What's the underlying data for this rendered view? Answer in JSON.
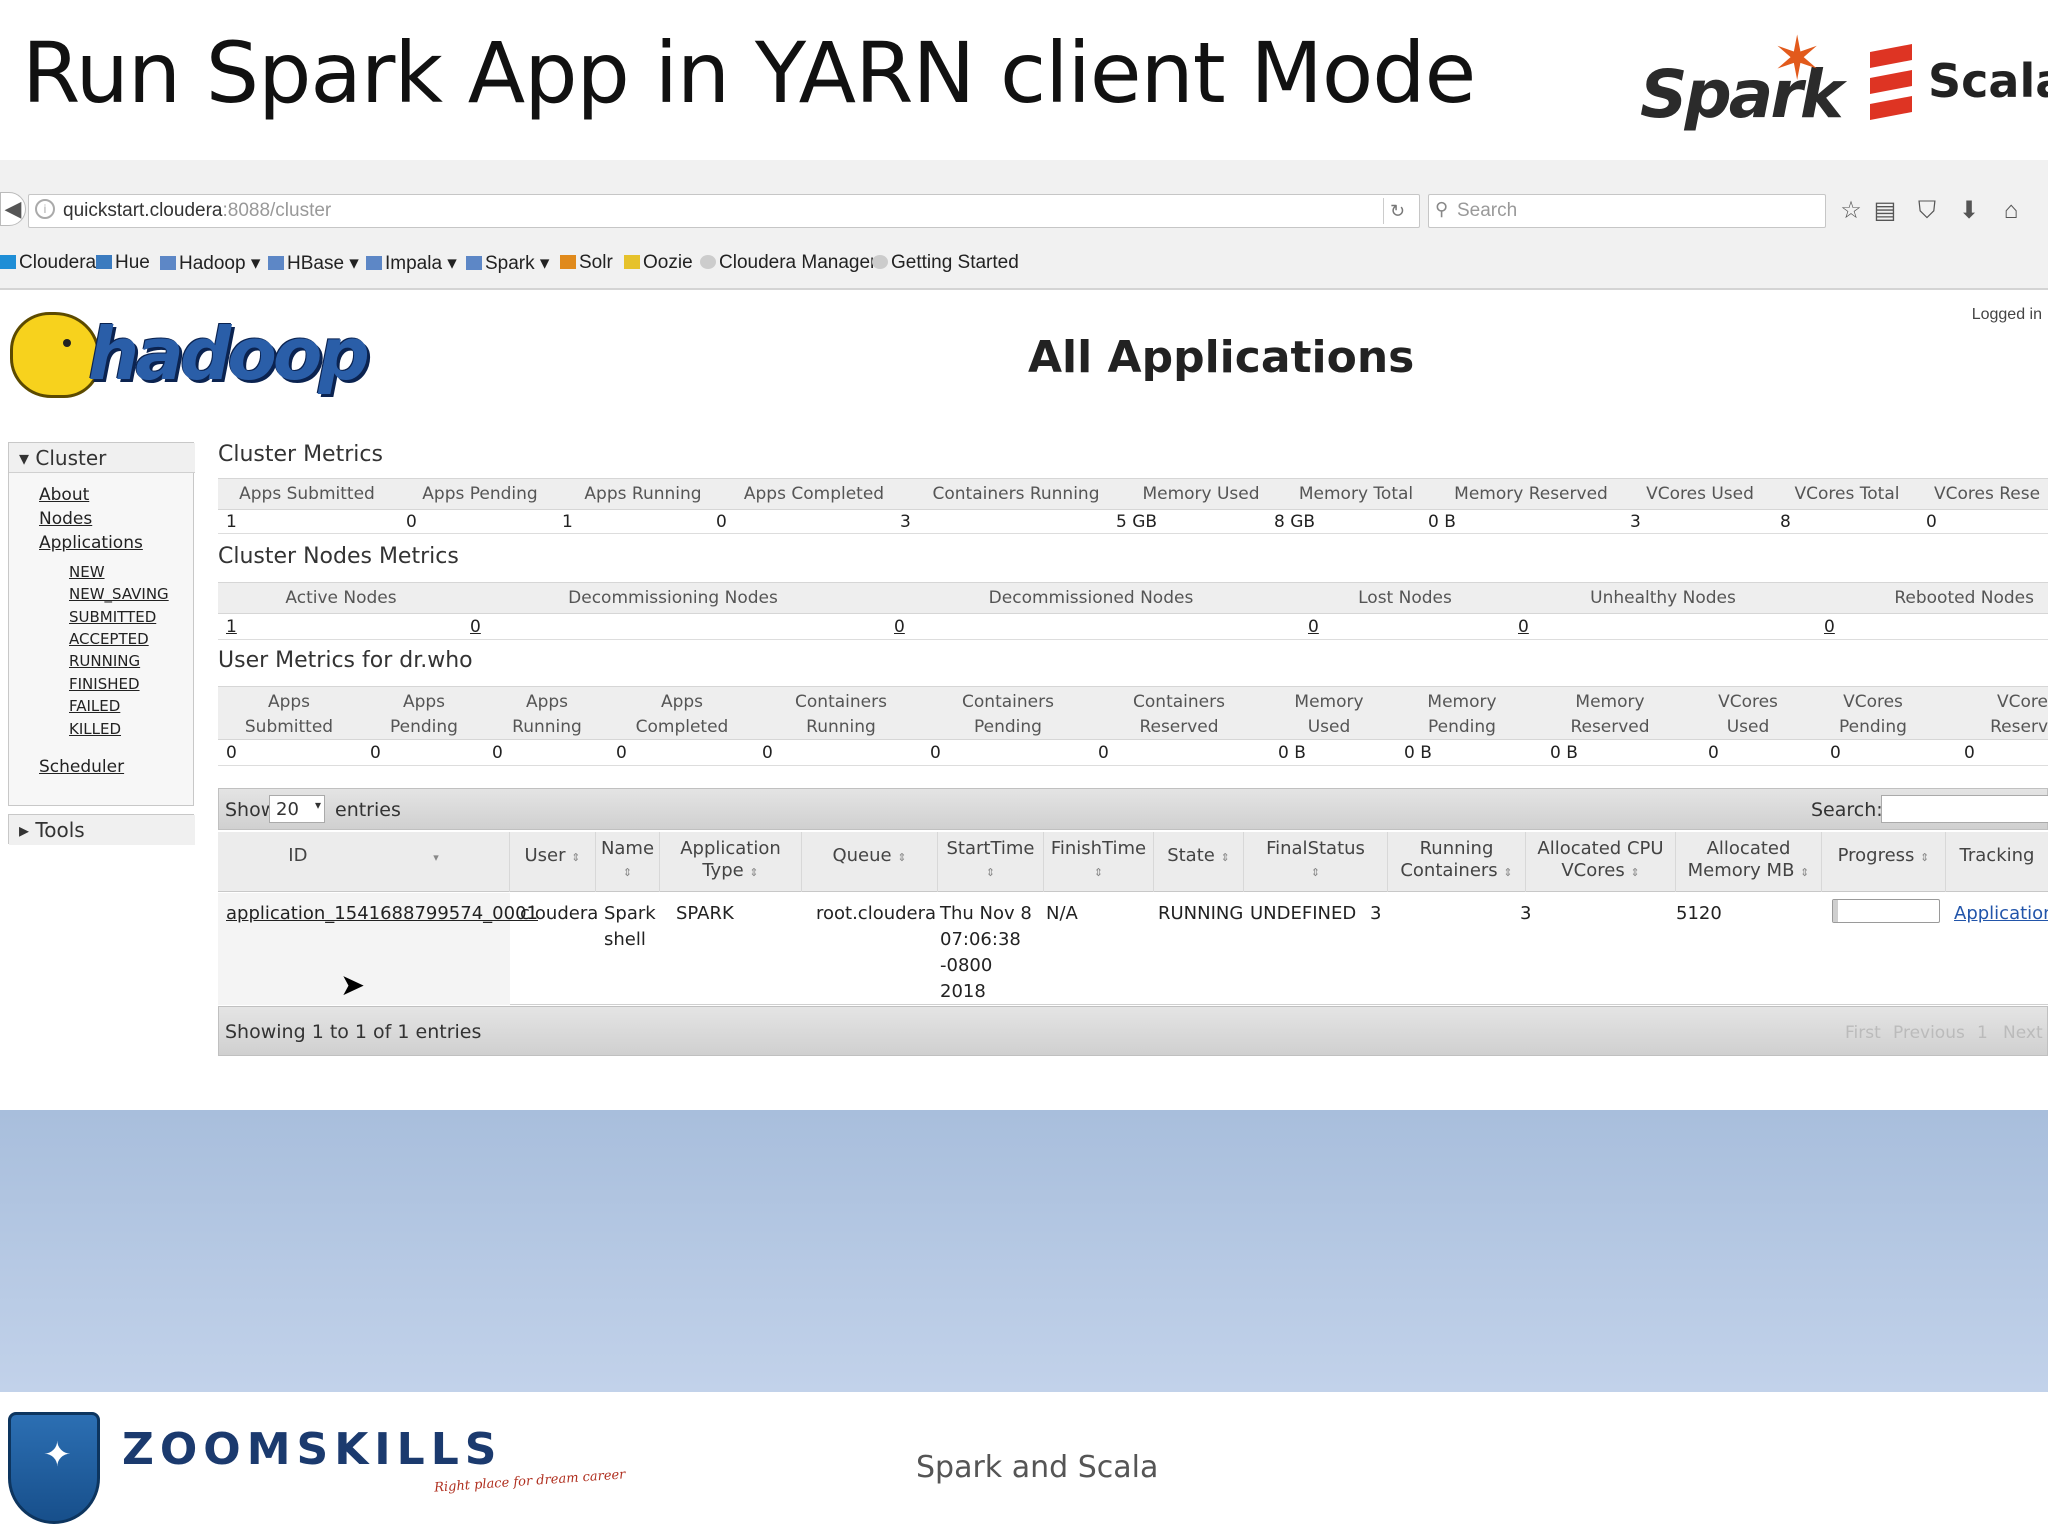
{
  "slide": {
    "title": "Run Spark App in YARN client Mode",
    "spark_logo_text": "Spark",
    "scala_logo_text": "Scala",
    "footer_text": "Spark and Scala",
    "brand": "ZOOMSKILLS",
    "brand_tagline": "Right place for dream career"
  },
  "browser": {
    "url_host": "quickstart.cloudera",
    "url_path": ":8088/cluster",
    "search_placeholder": "Search",
    "bookmarks": [
      "Cloudera",
      "Hue",
      "Hadoop",
      "HBase",
      "Impala",
      "Spark",
      "Solr",
      "Oozie",
      "Cloudera Manager",
      "Getting Started"
    ]
  },
  "page": {
    "logo_text": "hadoop",
    "title": "All Applications",
    "logged_in": "Logged in"
  },
  "sidebar": {
    "cluster_label": "Cluster",
    "links": [
      "About",
      "Nodes",
      "Applications"
    ],
    "app_states": [
      "NEW",
      "NEW_SAVING",
      "SUBMITTED",
      "ACCEPTED",
      "RUNNING",
      "FINISHED",
      "FAILED",
      "KILLED"
    ],
    "scheduler": "Scheduler",
    "tools_label": "Tools"
  },
  "cluster_metrics": {
    "title": "Cluster Metrics",
    "headers": [
      "Apps Submitted",
      "Apps Pending",
      "Apps Running",
      "Apps Completed",
      "Containers Running",
      "Memory Used",
      "Memory Total",
      "Memory Reserved",
      "VCores Used",
      "VCores Total",
      "VCores Rese"
    ],
    "values": [
      "1",
      "0",
      "1",
      "0",
      "3",
      "5 GB",
      "8 GB",
      "0 B",
      "3",
      "8",
      "0"
    ]
  },
  "node_metrics": {
    "title": "Cluster Nodes Metrics",
    "headers": [
      "Active Nodes",
      "Decommissioning Nodes",
      "Decommissioned Nodes",
      "Lost Nodes",
      "Unhealthy Nodes",
      "Rebooted Nodes"
    ],
    "values": [
      "1",
      "0",
      "0",
      "0",
      "0",
      "0"
    ]
  },
  "user_metrics": {
    "title": "User Metrics for dr.who",
    "headers": [
      [
        "Apps",
        "Submitted"
      ],
      [
        "Apps",
        "Pending"
      ],
      [
        "Apps",
        "Running"
      ],
      [
        "Apps",
        "Completed"
      ],
      [
        "Containers",
        "Running"
      ],
      [
        "Containers",
        "Pending"
      ],
      [
        "Containers",
        "Reserved"
      ],
      [
        "Memory",
        "Used"
      ],
      [
        "Memory",
        "Pending"
      ],
      [
        "Memory",
        "Reserved"
      ],
      [
        "VCores",
        "Used"
      ],
      [
        "VCores",
        "Pending"
      ],
      [
        "VCore",
        "Reserv"
      ]
    ],
    "values": [
      "0",
      "0",
      "0",
      "0",
      "0",
      "0",
      "0",
      "0 B",
      "0 B",
      "0 B",
      "0",
      "0",
      "0"
    ]
  },
  "apps_table": {
    "show_label": "Show",
    "show_value": "20",
    "entries_label": "entries",
    "search_label": "Search:",
    "headers": [
      [
        "ID"
      ],
      [
        "User"
      ],
      [
        "Name"
      ],
      [
        "Application",
        "Type"
      ],
      [
        "Queue"
      ],
      [
        "StartTime"
      ],
      [
        "FinishTime"
      ],
      [
        "State"
      ],
      [
        "FinalStatus"
      ],
      [
        "Running",
        "Containers"
      ],
      [
        "Allocated CPU",
        "VCores"
      ],
      [
        "Allocated",
        "Memory MB"
      ],
      [
        "Progress"
      ],
      [
        "Tracking"
      ]
    ],
    "row": {
      "id": "application_1541688799574_0001",
      "user": "cloudera",
      "name_lines": [
        "Spark",
        "shell"
      ],
      "type": "SPARK",
      "queue": "root.cloudera",
      "start_lines": [
        "Thu Nov 8",
        "07:06:38",
        "-0800",
        "2018"
      ],
      "finish": "N/A",
      "state": "RUNNING",
      "final_status": "UNDEFINED",
      "running_containers": "3",
      "allocated_vcores": "3",
      "allocated_memory": "5120",
      "progress": 0.05,
      "tracking": "ApplicationMaster"
    },
    "showing": "Showing 1 to 1 of 1 entries",
    "pager": [
      "First",
      "Previous",
      "1",
      "Next"
    ]
  },
  "colors": {
    "spark_orange": "#e25a1c",
    "scala_red": "#de3423",
    "hadoop_blue": "#2a5ea8",
    "band_blue": "#b3c7e4"
  }
}
